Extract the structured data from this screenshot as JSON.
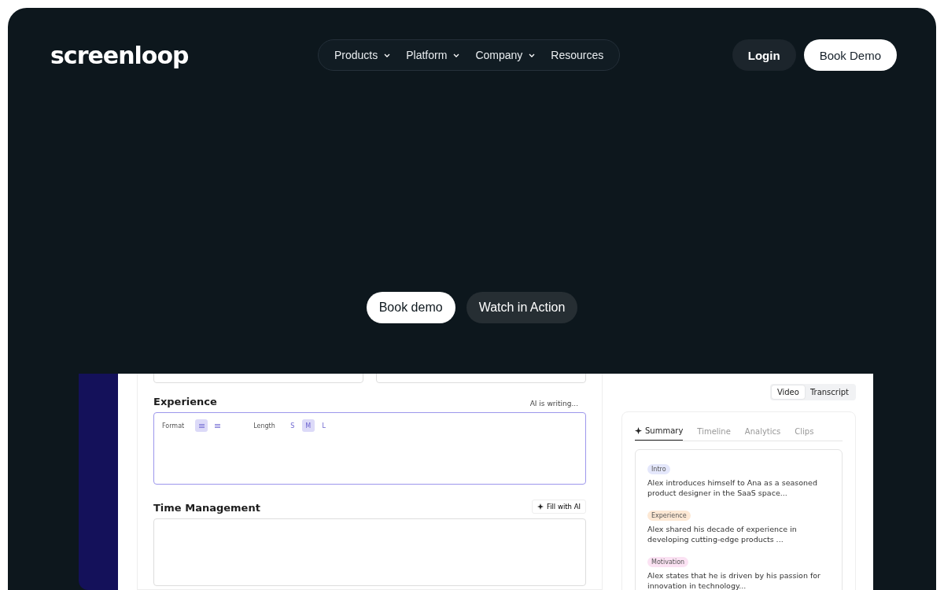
{
  "logo": "screenloop",
  "nav": [
    {
      "label": "Products",
      "dropdown": true
    },
    {
      "label": "Platform",
      "dropdown": true
    },
    {
      "label": "Company",
      "dropdown": true
    },
    {
      "label": "Resources",
      "dropdown": false
    }
  ],
  "login": "Login",
  "book_demo": "Book Demo",
  "hero_buttons": [
    {
      "label": "Book demo",
      "kind": "primary"
    },
    {
      "label": "Watch in Action",
      "kind": "secondary"
    }
  ],
  "form": {
    "sections": [
      {
        "title": "Experience",
        "status": "AI is writing...",
        "active": true,
        "format_label": "Format",
        "formats": [
          {
            "selected": true
          },
          {
            "selected": false
          }
        ],
        "length_label": "Length",
        "lengths": [
          {
            "label": "S",
            "selected": false
          },
          {
            "label": "M",
            "selected": true
          },
          {
            "label": "L",
            "selected": false
          }
        ]
      },
      {
        "title": "Time Management",
        "action": "Fill with AI",
        "active": false
      }
    ]
  },
  "view_toggle": [
    {
      "label": "Video",
      "selected": true
    },
    {
      "label": "Transcript",
      "selected": false
    }
  ],
  "tabs": [
    {
      "label": "Summary",
      "selected": true
    },
    {
      "label": "Timeline",
      "selected": false
    },
    {
      "label": "Analytics",
      "selected": false
    },
    {
      "label": "Clips",
      "selected": false
    }
  ],
  "summary": [
    {
      "tag": "Intro",
      "color": "#e4e7fb",
      "text": "Alex introduces himself to Ana as a seasoned product designer in the SaaS space..."
    },
    {
      "tag": "Experience",
      "color": "#fde8d4",
      "text": "Alex shared his decade of experience in developing cutting-edge products ..."
    },
    {
      "tag": "Motivation",
      "color": "#fbe2f3",
      "text": "Alex states that he is driven by his passion for innovation in technology..."
    }
  ]
}
